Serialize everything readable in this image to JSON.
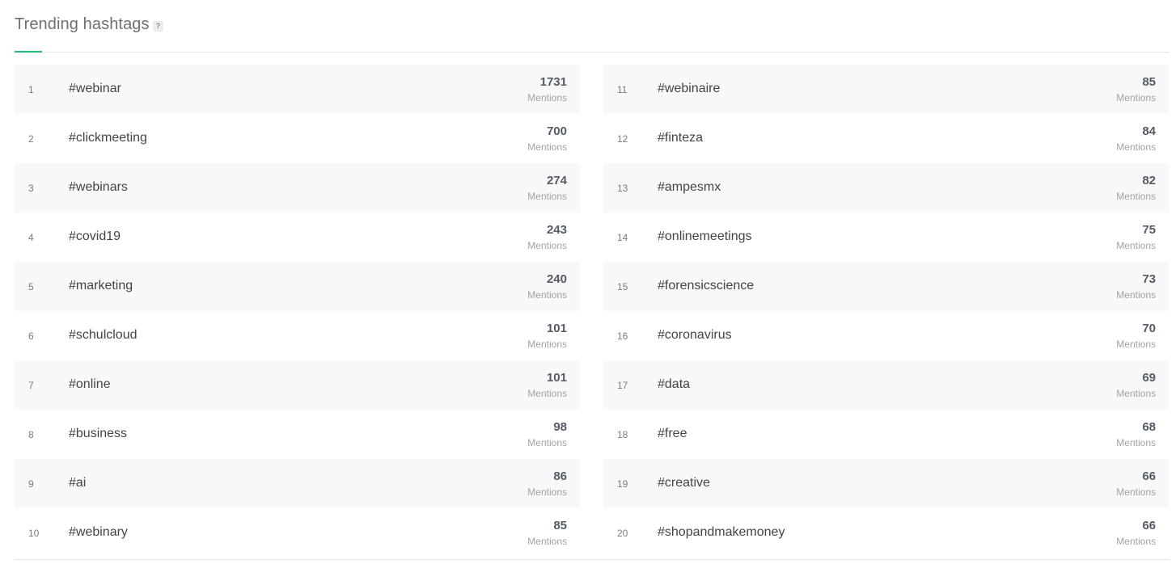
{
  "header": {
    "title": "Trending hashtags",
    "help_label": "?"
  },
  "mentions_label": "Mentions",
  "left": [
    {
      "rank": "1",
      "tag": "#webinar",
      "count": "1731"
    },
    {
      "rank": "2",
      "tag": "#clickmeeting",
      "count": "700"
    },
    {
      "rank": "3",
      "tag": "#webinars",
      "count": "274"
    },
    {
      "rank": "4",
      "tag": "#covid19",
      "count": "243"
    },
    {
      "rank": "5",
      "tag": "#marketing",
      "count": "240"
    },
    {
      "rank": "6",
      "tag": "#schulcloud",
      "count": "101"
    },
    {
      "rank": "7",
      "tag": "#online",
      "count": "101"
    },
    {
      "rank": "8",
      "tag": "#business",
      "count": "98"
    },
    {
      "rank": "9",
      "tag": "#ai",
      "count": "86"
    },
    {
      "rank": "10",
      "tag": "#webinary",
      "count": "85"
    }
  ],
  "right": [
    {
      "rank": "11",
      "tag": "#webinaire",
      "count": "85"
    },
    {
      "rank": "12",
      "tag": "#finteza",
      "count": "84"
    },
    {
      "rank": "13",
      "tag": "#ampesmx",
      "count": "82"
    },
    {
      "rank": "14",
      "tag": "#onlinemeetings",
      "count": "75"
    },
    {
      "rank": "15",
      "tag": "#forensicscience",
      "count": "73"
    },
    {
      "rank": "16",
      "tag": "#coronavirus",
      "count": "70"
    },
    {
      "rank": "17",
      "tag": "#data",
      "count": "69"
    },
    {
      "rank": "18",
      "tag": "#free",
      "count": "68"
    },
    {
      "rank": "19",
      "tag": "#creative",
      "count": "66"
    },
    {
      "rank": "20",
      "tag": "#shopandmakemoney",
      "count": "66"
    }
  ],
  "colors": {
    "accent": "#1fbf75",
    "row_shade": "#f8f8f8"
  }
}
